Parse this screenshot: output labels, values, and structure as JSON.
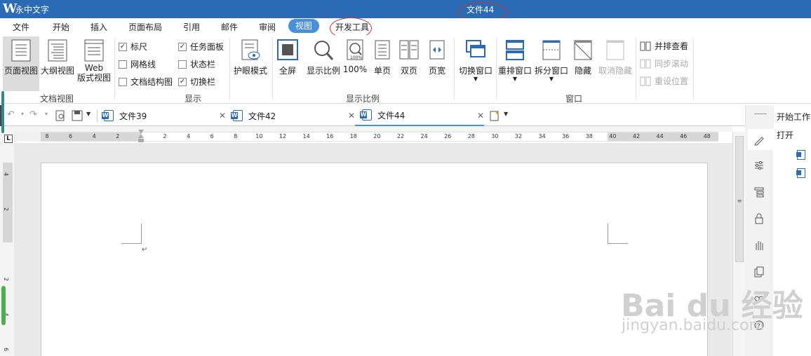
{
  "titlebar": {
    "app_name": "永中文字",
    "doc_title": "文件44"
  },
  "menu": [
    "文件",
    "开始",
    "插入",
    "页面布局",
    "引用",
    "邮件",
    "审阅",
    "视图",
    "开发工具"
  ],
  "ribbon": {
    "doc_view": {
      "page_view": "页面视图",
      "outline_view": "大纲视图",
      "web_view_1": "Web",
      "web_view_2": "版式视图",
      "group": "文档视图"
    },
    "show": {
      "ruler": "标尺",
      "gridlines": "网格线",
      "doc_map": "文档结构图",
      "task_pane": "任务面板",
      "status_bar": "状态栏",
      "switch_bar": "切换栏",
      "group": "显示",
      "checked": {
        "ruler": true,
        "gridlines": false,
        "doc_map": false,
        "task_pane": true,
        "status_bar": false,
        "switch_bar": true
      }
    },
    "eye_mode": "护眼模式",
    "zoom": {
      "fullscreen": "全屏",
      "ratio": "显示比例",
      "p100": "100%",
      "single": "单页",
      "double": "双页",
      "width": "页宽",
      "group": "显示比例"
    },
    "window": {
      "switch": "切换窗口",
      "rearrange": "重排窗口",
      "split": "拆分窗口",
      "hide": "隐藏",
      "unhide": "取消隐藏",
      "group": "窗口"
    },
    "side_by_side": "并排查看",
    "sync_scroll": "同步滚动",
    "reset_pos": "重设位置"
  },
  "tabs": [
    "文件39",
    "文件42",
    "文件44"
  ],
  "ruler_h": [
    "8",
    "6",
    "4",
    "2",
    "2",
    "4",
    "6",
    "8",
    "10",
    "12",
    "14",
    "16",
    "18",
    "20",
    "22",
    "24",
    "26",
    "28",
    "30",
    "32",
    "34",
    "36",
    "38",
    "40",
    "42",
    "44",
    "46",
    "48"
  ],
  "ruler_v": [
    "4",
    "2",
    "2",
    "4",
    "6"
  ],
  "sidebar": {
    "title": "开始工作",
    "open": "打开"
  },
  "watermark": {
    "main": "Bai du 经验",
    "sub": "jingyan.baidu.com"
  },
  "colors": {
    "titlebar": "#2b6ab5",
    "active_menu": "#4a90d9",
    "annotation": "#c0392b"
  }
}
